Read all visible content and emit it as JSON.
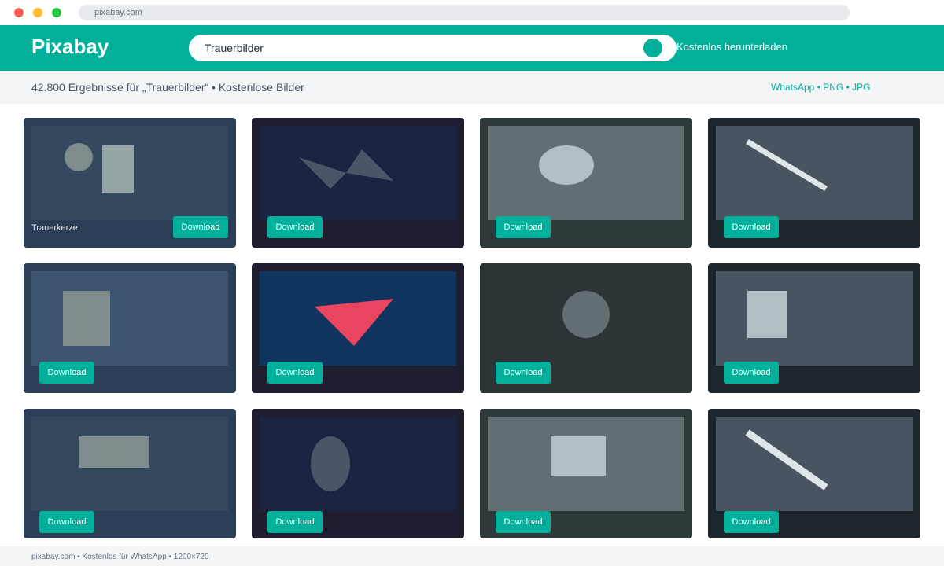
{
  "browser": {
    "url": "pixabay.com"
  },
  "header": {
    "logo": "Pixabay",
    "search_value": "Trauerbilder",
    "link": "Kostenlos herunterladen"
  },
  "results": {
    "summary": "42.800 Ergebnisse für „Trauerbilder“ • Kostenlose Bilder",
    "filters": "WhatsApp • PNG • JPG"
  },
  "cards": [
    {
      "caption": "Trauerkerze",
      "button": "Download"
    },
    {
      "caption": "",
      "button": "Download"
    },
    {
      "caption": "",
      "button": "Download"
    },
    {
      "caption": "",
      "button": "Download"
    },
    {
      "caption": "",
      "button": "Download"
    },
    {
      "caption": "",
      "button": "Download"
    },
    {
      "caption": "",
      "button": "Download"
    },
    {
      "caption": "",
      "button": "Download"
    },
    {
      "caption": "",
      "button": "Download"
    },
    {
      "caption": "",
      "button": "Download"
    },
    {
      "caption": "",
      "button": "Download"
    },
    {
      "caption": "",
      "button": "Download"
    }
  ],
  "colors": {
    "accent": "#00b09b",
    "accent_red": "#e94560"
  },
  "footer": {
    "text": "pixabay.com • Kostenlos für WhatsApp • 1200×720"
  }
}
